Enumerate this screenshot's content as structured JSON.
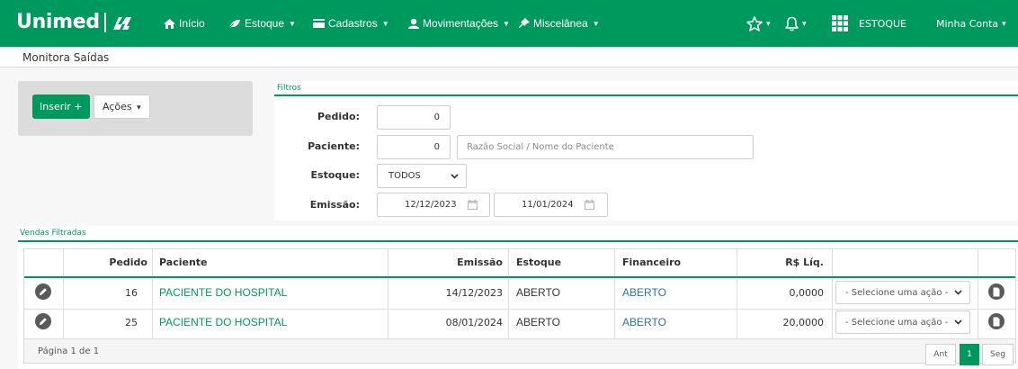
{
  "nav": {
    "brand": "Unimed",
    "items": [
      {
        "label": "Início",
        "caret": ""
      },
      {
        "label": "Estoque",
        "caret": "▼"
      },
      {
        "label": "Cadastros",
        "caret": "▼"
      },
      {
        "label": "Movimentações",
        "caret": "▼"
      },
      {
        "label": "Miscelânea",
        "caret": "▼"
      }
    ],
    "star_caret": "▾",
    "bell_caret": "▾",
    "module_label": "ESTOQUE",
    "account_label": "Minha Conta",
    "account_caret": "▾"
  },
  "page": {
    "title": "Monitora Saídas"
  },
  "actions": {
    "insert_label": "Inserir +",
    "actions_label": "Ações",
    "actions_caret": "▾"
  },
  "filters": {
    "title": "Filtros",
    "pedido_label": "Pedido:",
    "pedido_value": "0",
    "paciente_label": "Paciente:",
    "paciente_value": "0",
    "paciente_name_placeholder": "Razão Social / Nome do Paciente",
    "estoque_label": "Estoque:",
    "estoque_value": "TODOS",
    "emissao_label": "Emissão:",
    "date_from": "12/12/2023",
    "date_to": "11/01/2024"
  },
  "sales": {
    "title": "Vendas Filtradas",
    "columns": {
      "pedido": "Pedido",
      "paciente": "Paciente",
      "emissao": "Emissão",
      "estoque": "Estoque",
      "financeiro": "Financeiro",
      "valor": "R$ Líq."
    },
    "rows": [
      {
        "pedido": "16",
        "paciente": "PACIENTE DO HOSPITAL",
        "emissao": "14/12/2023",
        "estoque": "ABERTO",
        "financeiro": "ABERTO",
        "valor": "0,0000",
        "acao": "- Selecione uma ação -"
      },
      {
        "pedido": "25",
        "paciente": "PACIENTE DO HOSPITAL",
        "emissao": "08/01/2024",
        "estoque": "ABERTO",
        "financeiro": "ABERTO",
        "valor": "20,0000",
        "acao": "- Selecione uma ação -"
      }
    ],
    "page_info": "Página 1 de 1",
    "pager": {
      "prev": "Ant",
      "current": "1",
      "next": "Seg"
    }
  },
  "colors": {
    "brand_green": "#00995d",
    "link_blue": "#2a6ebb"
  },
  "icons": [
    "home-icon",
    "leaf-icon",
    "card-icon",
    "user-icon",
    "pin-icon",
    "star-icon",
    "bell-icon",
    "grid-icon",
    "calendar-icon",
    "pencil-icon",
    "document-icon",
    "chevron-down-icon"
  ]
}
